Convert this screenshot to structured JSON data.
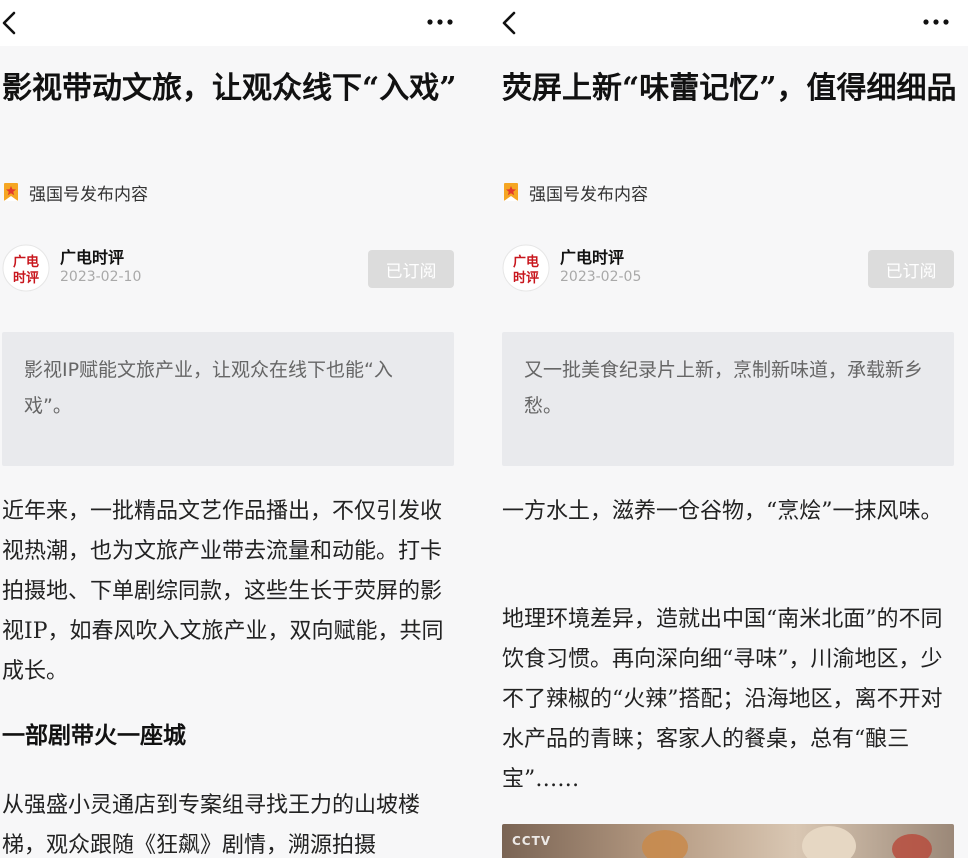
{
  "left_article": {
    "title": "影视带动文旅，让观众线下“入戏”",
    "badge": "强国号发布内容",
    "author": {
      "name": "广电时评",
      "date": "2023-02-10",
      "avatar_text": "广电时评"
    },
    "subscribe_label": "已订阅",
    "summary": "影视IP赋能文旅产业，让观众在线下也能“入戏”。",
    "paragraph_1": "近年来，一批精品文艺作品播出，不仅引发收视热潮，也为文旅产业带去流量和动能。打卡拍摄地、下单剧综同款，这些生长于荧屏的影视IP，如春风吹入文旅产业，双向赋能，共同成长。",
    "section_heading": "一部剧带火一座城",
    "paragraph_2": "从强盛小灵通店到专案组寻找王力的山坡楼梯，观众跟随《狂飙》剧情，溯源拍摄"
  },
  "right_article": {
    "title": "荧屏上新“味蕾记忆”，值得细细品",
    "badge": "强国号发布内容",
    "author": {
      "name": "广电时评",
      "date": "2023-02-05",
      "avatar_text": "广电时评"
    },
    "subscribe_label": "已订阅",
    "summary": "又一批美食纪录片上新，烹制新味道，承载新乡愁。",
    "paragraph_1": "一方水土，滋养一仓谷物，“烹烩”一抹风味。",
    "paragraph_2": "地理环境差异，造就出中国“南米北面”的不同饮食习惯。再向深向细“寻味”，川渝地区，少不了辣椒的“火辣”搭配；沿海地区，离不开对水产品的青睐；客家人的餐桌，总有“酿三宝”……",
    "video_channel_logo": "CCTV"
  },
  "colors": {
    "subscribed_button_bg": "#dcdcdc",
    "summary_bg": "#e9eaed",
    "badge_red": "#e23b2e",
    "avatar_red": "#c8161d"
  },
  "icons": {
    "back": "chevron-left-icon",
    "more": "more-dots-icon",
    "badge": "ribbon-star-icon"
  }
}
